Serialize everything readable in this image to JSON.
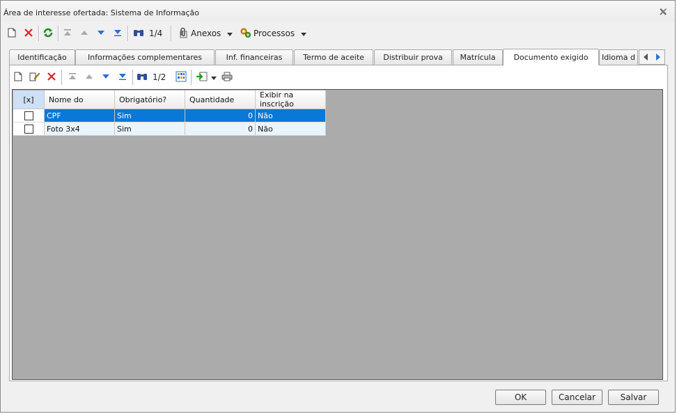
{
  "window": {
    "title": "Área de interesse ofertada: Sistema de Informação"
  },
  "toolbar": {
    "record_counter": "1/4",
    "anexos_label": "Anexos",
    "processos_label": "Processos"
  },
  "tabs": [
    {
      "label": "Identificação"
    },
    {
      "label": "Informações complementares"
    },
    {
      "label": "Inf. financeiras"
    },
    {
      "label": "Termo de aceite"
    },
    {
      "label": "Distribuir prova"
    },
    {
      "label": "Matrícula"
    },
    {
      "label": "Documento exigido",
      "active": true
    },
    {
      "label": "Idioma d"
    }
  ],
  "subtoolbar": {
    "record_counter": "1/2"
  },
  "grid": {
    "columns": [
      "[x]",
      "Nome do",
      "Obrigatório?",
      "Quantidade",
      "Exibir na inscrição"
    ],
    "rows": [
      {
        "nome": "CPF",
        "obrigatorio": "Sim",
        "quantidade": "0",
        "exibir": "Não",
        "selected": true
      },
      {
        "nome": "Foto 3x4",
        "obrigatorio": "Sim",
        "quantidade": "0",
        "exibir": "Não",
        "selected": false
      }
    ]
  },
  "footer": {
    "ok": "OK",
    "cancel": "Cancelar",
    "save": "Salvar"
  },
  "colors": {
    "selection": "#0a78d7",
    "grid_bg": "#ababab",
    "row_bg": "#eaf4fe"
  }
}
